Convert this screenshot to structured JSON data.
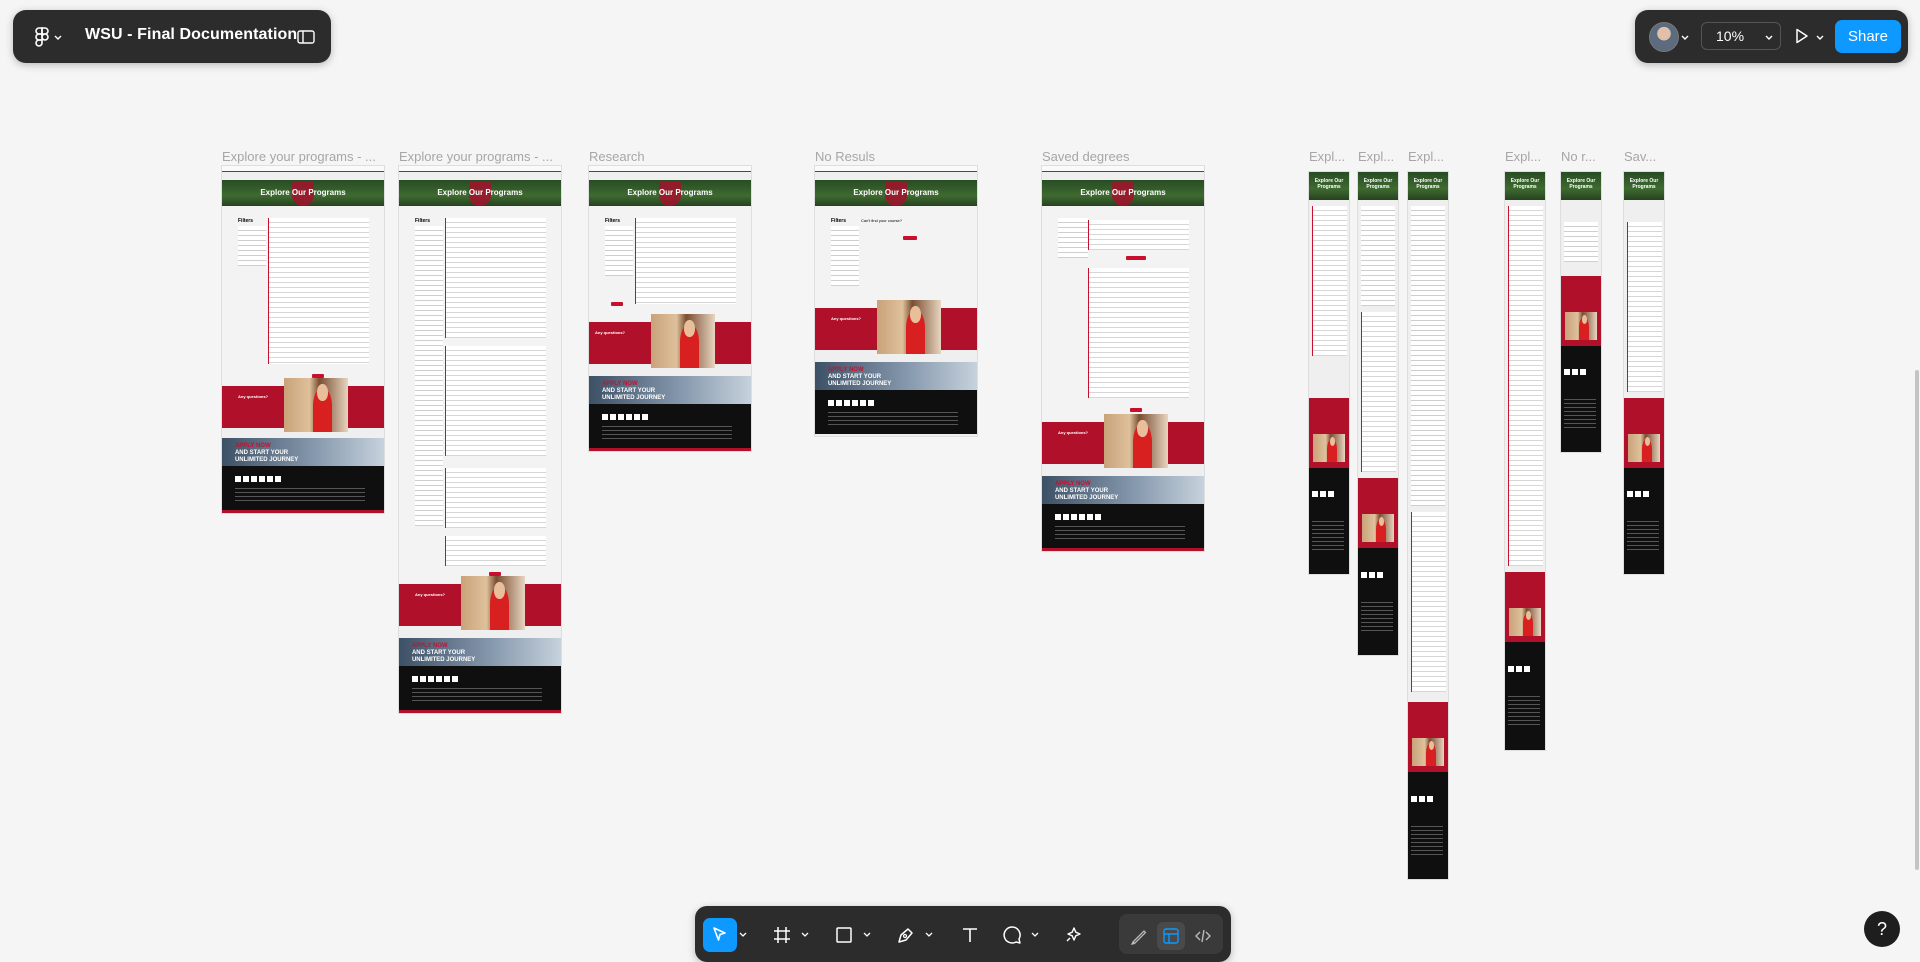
{
  "app": {
    "file_title": "WSU - Final Documentation"
  },
  "header": {
    "zoom_value": "10%",
    "share_label": "Share"
  },
  "canvas": {
    "frames": [
      {
        "label": "Explore your programs - ...",
        "hero_title": "Explore Our Programs"
      },
      {
        "label": "Explore your programs - ...",
        "hero_title": "Explore Our Programs"
      },
      {
        "label": "Research",
        "hero_title": "Explore Our Programs"
      },
      {
        "label": "No Resuls",
        "hero_title": "Explore Our Programs"
      },
      {
        "label": "Saved degrees",
        "hero_title": "Explore Our Programs"
      },
      {
        "label": "Expl...",
        "hero_title": "Explore Our Programs"
      },
      {
        "label": "Expl...",
        "hero_title": "Explore Our Programs"
      },
      {
        "label": "Expl...",
        "hero_title": "Explore Our Programs"
      },
      {
        "label": "Expl...",
        "hero_title": "Explore Our Programs"
      },
      {
        "label": "No r...",
        "hero_title": "Explore Our Programs"
      },
      {
        "label": "Sav...",
        "hero_title": "Explore Our Programs"
      }
    ],
    "apply_text": [
      "APPLY NOW",
      "AND START YOUR",
      "UNLIMITED JOURNEY"
    ],
    "questions_text": "Any questions?",
    "filters_text": "Filters",
    "no_results_text": "Can't find your course?"
  },
  "toolbar": {
    "tools": [
      "move-tool",
      "frame-tool",
      "shape-tool",
      "pen-tool",
      "text-tool",
      "comment-tool",
      "actions-tool"
    ],
    "active_tool": "move-tool",
    "modes": [
      "draw-mode",
      "design-mode",
      "dev-mode"
    ],
    "active_mode": "design-mode"
  },
  "help_label": "?",
  "colors": {
    "accent": "#0d99ff",
    "wsu_red": "#c8102e",
    "ui_dark": "#2c2c2c"
  }
}
